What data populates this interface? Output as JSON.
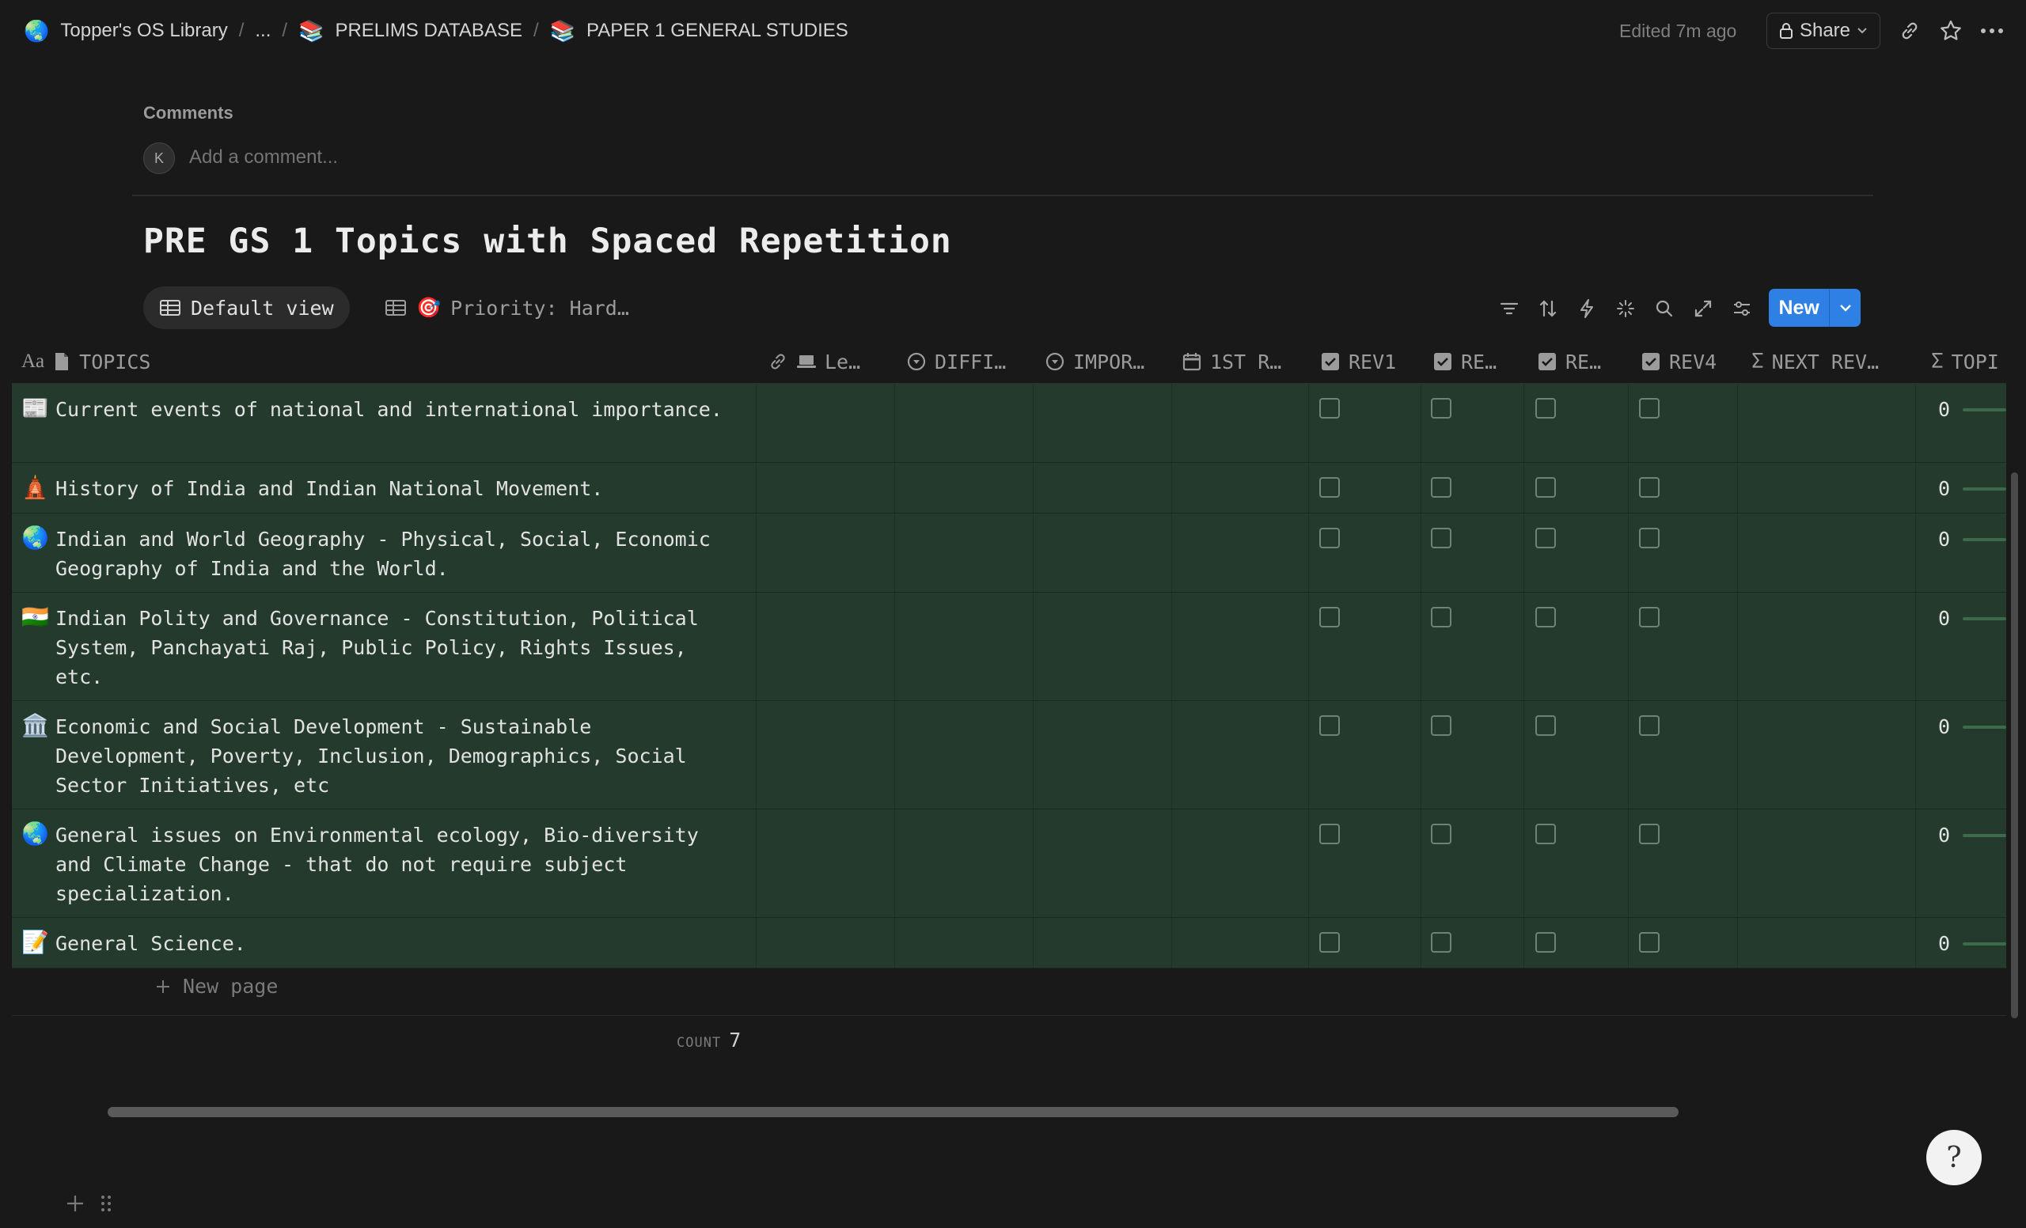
{
  "breadcrumb": [
    {
      "emoji": "🌏",
      "label": "Topper's OS Library"
    },
    {
      "emoji": "",
      "label": "..."
    },
    {
      "emoji": "📚",
      "label": "PRELIMS DATABASE"
    },
    {
      "emoji": "📚",
      "label": "PAPER 1 GENERAL STUDIES"
    }
  ],
  "topbar": {
    "edited": "Edited 7m ago",
    "share": "Share"
  },
  "comments": {
    "label": "Comments",
    "avatar": "K",
    "placeholder": "Add a comment..."
  },
  "database": {
    "title": "PRE GS 1 Topics with Spaced Repetition"
  },
  "views": {
    "default": "Default view",
    "priority_emoji": "🎯",
    "priority": "Priority: Hard…"
  },
  "toolbar": {
    "new_label": "New"
  },
  "columns": {
    "topics": "TOPICS",
    "lecture": "Le…",
    "difficulty": "DIFFI…",
    "importance": "IMPOR…",
    "first_rev": "1ST R…",
    "rev1": "REV1",
    "rev2": "RE…",
    "rev3": "RE…",
    "rev4": "REV4",
    "next_rev": "NEXT REV…",
    "topic_progress": "TOPI"
  },
  "rows": [
    {
      "emoji": "📰",
      "text": "Current events of national and international importance.",
      "value": "0"
    },
    {
      "emoji": "🛕",
      "text": "History of India and Indian National Movement.",
      "value": "0"
    },
    {
      "emoji": "🌏",
      "text": "Indian and World Geography - Physical, Social, Economic Geography of India and the World.",
      "value": "0"
    },
    {
      "emoji": "🇮🇳",
      "text": "Indian Polity and Governance - Constitution, Political System, Panchayati Raj, Public Policy, Rights Issues, etc.",
      "value": "0"
    },
    {
      "emoji": "🏛️",
      "text": "Economic and Social Development - Sustainable Development, Poverty, Inclusion, Demographics, Social Sector Initiatives, etc",
      "value": "0"
    },
    {
      "emoji": "🌏",
      "text": "General issues on Environmental ecology, Bio-diversity and Climate Change - that do not require subject specialization.",
      "value": "0"
    },
    {
      "emoji": "📝",
      "text": "General Science.",
      "value": "0"
    }
  ],
  "footer": {
    "new_page": "New page",
    "count_label": "COUNT",
    "count_value": "7"
  },
  "colors": {
    "background": "#191919",
    "row_bg": "#233a2c",
    "accent": "#2f80e5"
  }
}
